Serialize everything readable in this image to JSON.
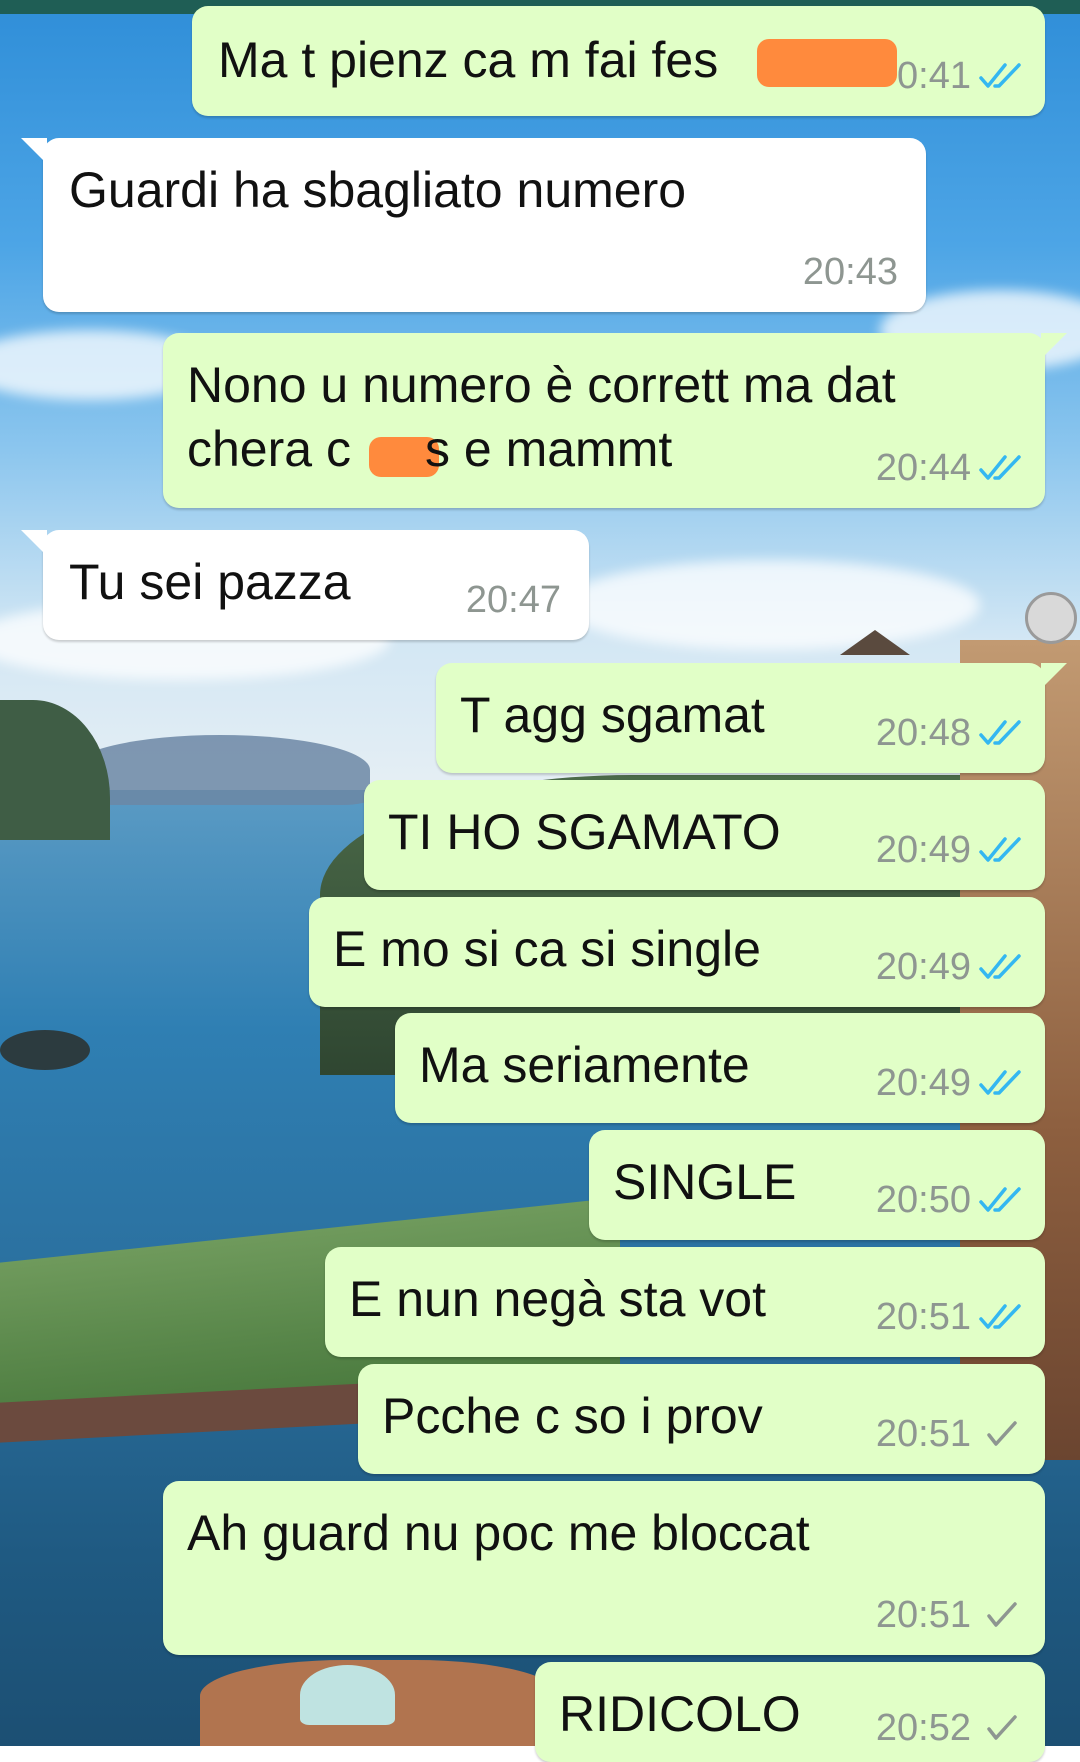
{
  "colors": {
    "outgoing_bubble": "#e1ffc7",
    "incoming_bubble": "#ffffff",
    "timestamp": "#8e9691",
    "read_ticks": "#34b7f1",
    "sent_tick": "#8e9691",
    "redaction": "#ff8a3d"
  },
  "messages": [
    {
      "direction": "out",
      "text": "Ma t pienz ca m fai fes",
      "time": "0:41",
      "status": "read"
    },
    {
      "direction": "in",
      "text": "Guardi ha sbagliato numero",
      "time": "20:43"
    },
    {
      "direction": "out",
      "line1": "Nono u numero è corrett ma dat",
      "line2a": "chera c",
      "line2b": "s e mammt",
      "time": "20:44",
      "status": "read"
    },
    {
      "direction": "in",
      "text": "Tu sei pazza",
      "time": "20:47"
    },
    {
      "direction": "out",
      "text": "T agg sgamat",
      "time": "20:48",
      "status": "read"
    },
    {
      "direction": "out",
      "text": "TI HO SGAMATO",
      "time": "20:49",
      "status": "read"
    },
    {
      "direction": "out",
      "text": "E mo si ca si single",
      "time": "20:49",
      "status": "read"
    },
    {
      "direction": "out",
      "text": "Ma seriamente",
      "time": "20:49",
      "status": "read"
    },
    {
      "direction": "out",
      "text": "SINGLE",
      "time": "20:50",
      "status": "read"
    },
    {
      "direction": "out",
      "text": "E nun negà sta vot",
      "time": "20:51",
      "status": "read"
    },
    {
      "direction": "out",
      "text": "Pcche c so i prov",
      "time": "20:51",
      "status": "sent"
    },
    {
      "direction": "out",
      "text": "Ah guard nu poc me bloccat",
      "time": "20:51",
      "status": "sent"
    },
    {
      "direction": "out",
      "text": "RIDICOLO",
      "time": "20:52",
      "status": "sent"
    }
  ]
}
